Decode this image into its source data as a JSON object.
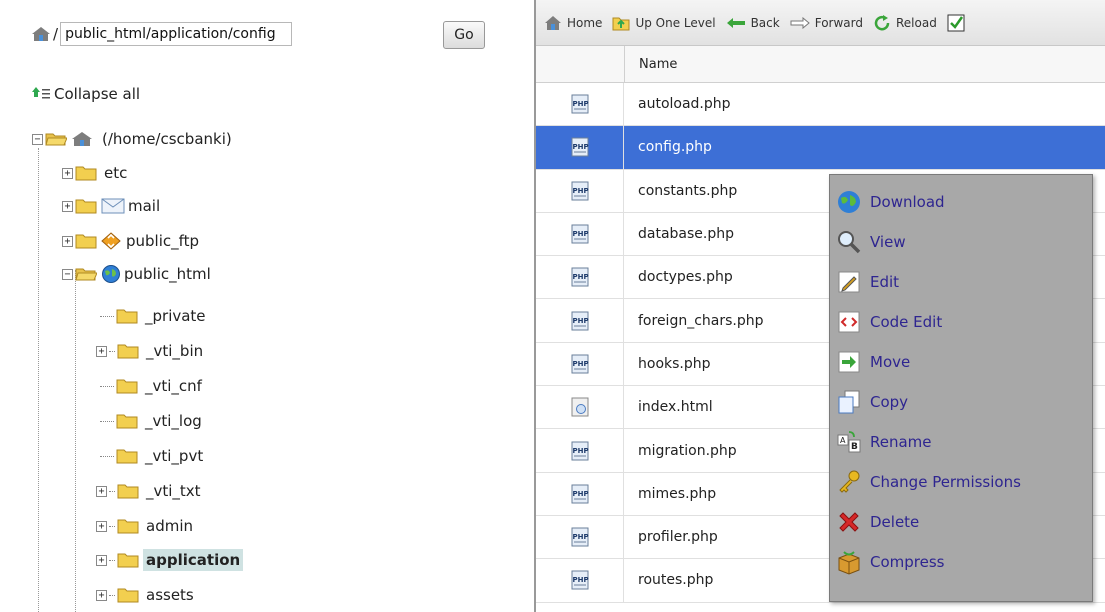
{
  "left": {
    "path_prefix": "/",
    "path_value": "public_html/application/config",
    "go_label": "Go",
    "collapse_label": "Collapse all",
    "tree": [
      {
        "label": "(/home/cscbanki)",
        "toggle": "−"
      },
      {
        "label": "etc",
        "toggle": "+"
      },
      {
        "label": "mail",
        "toggle": "+"
      },
      {
        "label": "public_ftp",
        "toggle": "+"
      },
      {
        "label": "public_html",
        "toggle": "−"
      },
      {
        "label": "_private",
        "toggle": ""
      },
      {
        "label": "_vti_bin",
        "toggle": "+"
      },
      {
        "label": "_vti_cnf",
        "toggle": ""
      },
      {
        "label": "_vti_log",
        "toggle": ""
      },
      {
        "label": "_vti_pvt",
        "toggle": ""
      },
      {
        "label": "_vti_txt",
        "toggle": "+"
      },
      {
        "label": "admin",
        "toggle": "+"
      },
      {
        "label": "application",
        "toggle": "+"
      },
      {
        "label": "assets",
        "toggle": "+"
      }
    ]
  },
  "toolbar": {
    "home": "Home",
    "up": "Up One Level",
    "back": "Back",
    "forward": "Forward",
    "reload": "Reload"
  },
  "table": {
    "header_name": "Name",
    "rows": [
      {
        "name": "autoload.php",
        "type": "php"
      },
      {
        "name": "config.php",
        "type": "php"
      },
      {
        "name": "constants.php",
        "type": "php"
      },
      {
        "name": "database.php",
        "type": "php"
      },
      {
        "name": "doctypes.php",
        "type": "php"
      },
      {
        "name": "foreign_chars.php",
        "type": "php"
      },
      {
        "name": "hooks.php",
        "type": "php"
      },
      {
        "name": "index.html",
        "type": "html"
      },
      {
        "name": "migration.php",
        "type": "php"
      },
      {
        "name": "mimes.php",
        "type": "php"
      },
      {
        "name": "profiler.php",
        "type": "php"
      },
      {
        "name": "routes.php",
        "type": "php"
      }
    ]
  },
  "context_menu": [
    {
      "label": "Download",
      "icon": "download-icon"
    },
    {
      "label": "View",
      "icon": "magnifier-icon"
    },
    {
      "label": "Edit",
      "icon": "pencil-icon"
    },
    {
      "label": "Code Edit",
      "icon": "code-edit-icon"
    },
    {
      "label": "Move",
      "icon": "move-arrow-icon"
    },
    {
      "label": "Copy",
      "icon": "copy-icon"
    },
    {
      "label": "Rename",
      "icon": "rename-ab-icon"
    },
    {
      "label": "Change Permissions",
      "icon": "key-icon"
    },
    {
      "label": "Delete",
      "icon": "red-x-icon"
    },
    {
      "label": "Compress",
      "icon": "compress-icon"
    }
  ],
  "colors": {
    "selection": "#3d6fd6",
    "menu_bg": "#a8a8a8",
    "menu_text": "#2e2590",
    "tree_highlight": "#cfe2e2"
  }
}
